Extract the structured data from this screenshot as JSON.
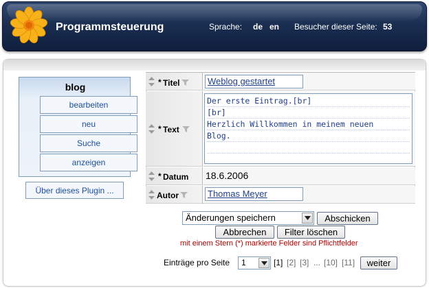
{
  "header": {
    "title": "Programmsteuerung",
    "language_label": "Sprache:",
    "languages": [
      "de",
      "en"
    ],
    "visitors_label": "Besucher dieser Seite:",
    "visitors_count": "53",
    "logo_icon": "orange-flower-icon"
  },
  "sidebar": {
    "title": "blog",
    "items": [
      {
        "label": "bearbeiten"
      },
      {
        "label": "neu"
      },
      {
        "label": "Suche"
      },
      {
        "label": "anzeigen"
      }
    ],
    "about_label": "Über dieses Plugin ..."
  },
  "form": {
    "required_mark": "*",
    "fields": [
      {
        "label": "Titel",
        "required": true,
        "value": "Weblog gestartet"
      },
      {
        "label": "Text",
        "required": true,
        "lines": [
          "Der erste Eintrag.[br]",
          "[br]",
          "Herzlich Willkommen in meinem neuen",
          "Blog."
        ]
      },
      {
        "label": "Datum",
        "required": true,
        "value": "18.6.2006"
      },
      {
        "label": "Autor",
        "required": false,
        "value": "Thomas Meyer"
      }
    ]
  },
  "actions": {
    "select_value": "Änderungen speichern",
    "submit_label": "Abschicken",
    "cancel_label": "Abbrechen",
    "clear_filter_label": "Filter löschen",
    "hint": "mit einem Stern (*) markierte Felder sind Pflichtfelder"
  },
  "pager": {
    "label": "Einträge pro Seite",
    "per_page_value": "1",
    "pages": [
      "[1]",
      "[2]",
      "[3]",
      "...",
      "[10]",
      "[11]"
    ],
    "current_page": "[1]",
    "next_label": "weiter"
  },
  "colors": {
    "header_bg": "#1b2f52",
    "link_blue": "#1c4fa0",
    "required_red": "#c00000",
    "hint_red": "#b00000"
  }
}
